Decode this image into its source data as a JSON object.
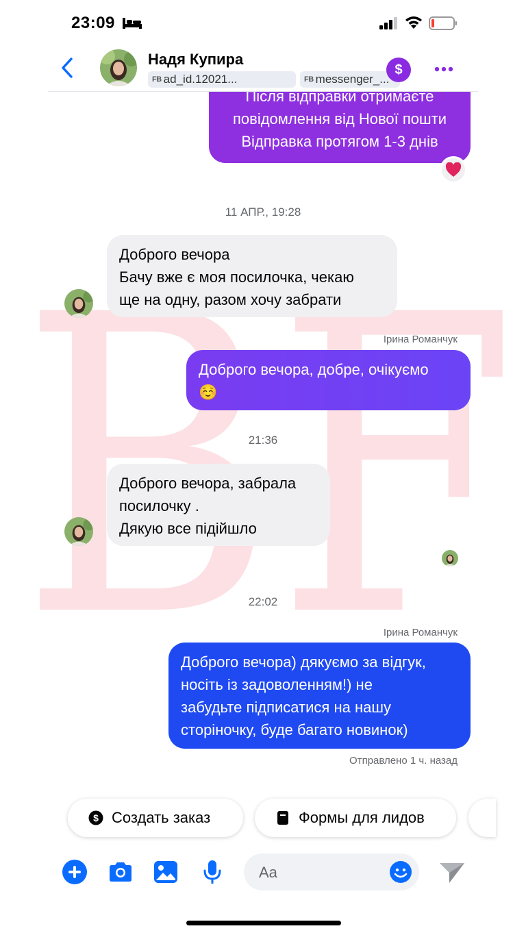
{
  "status_bar": {
    "time": "23:09"
  },
  "header": {
    "contact_name": "Надя Купира",
    "tags": [
      {
        "prefix": "FB",
        "label": "ad_id.12021..."
      },
      {
        "prefix": "FB",
        "label": "messenger_..."
      }
    ],
    "dollar_symbol": "$"
  },
  "messages": {
    "m0": {
      "lines": [
        "Після відправки отримаєте",
        "повідомлення від Нової пошти",
        "Відправка протягом 1-3 днів"
      ],
      "reaction": "❤️"
    },
    "ts1": "11 АПР., 19:28",
    "m1": {
      "lines": [
        "Доброго вечора",
        "Бачу вже є моя посилочка, чекаю",
        "ще на одну, разом хочу забрати"
      ]
    },
    "sender2": "Ірина Романчук",
    "m2": {
      "lines": [
        "Доброго вечора, добре, очікуємо",
        "☺️"
      ]
    },
    "ts2": "21:36",
    "m3": {
      "lines": [
        "Доброго вечора, забрала",
        "посилочку .",
        "Дякую все підійшло"
      ]
    },
    "ts3": "22:02",
    "sender4": "Ірина Романчук",
    "m4": {
      "lines": [
        "Доброго вечора) дякуємо за відгук,",
        "носіть із задоволенням!) не",
        "забудьте підписатися на нашу",
        "сторіночку, буде багато новинок)"
      ]
    },
    "sent_status": "Отправлено 1 ч. назад"
  },
  "quick_actions": {
    "create_order": "Создать заказ",
    "lead_forms": "Формы для лидов"
  },
  "composer": {
    "placeholder": "Aa"
  },
  "colors": {
    "accent": "#0a6cff",
    "purple": "#8e2fe0",
    "blue_bubble": "#1f4af2",
    "watermark": "#f9c8d0"
  },
  "watermark": "BF"
}
